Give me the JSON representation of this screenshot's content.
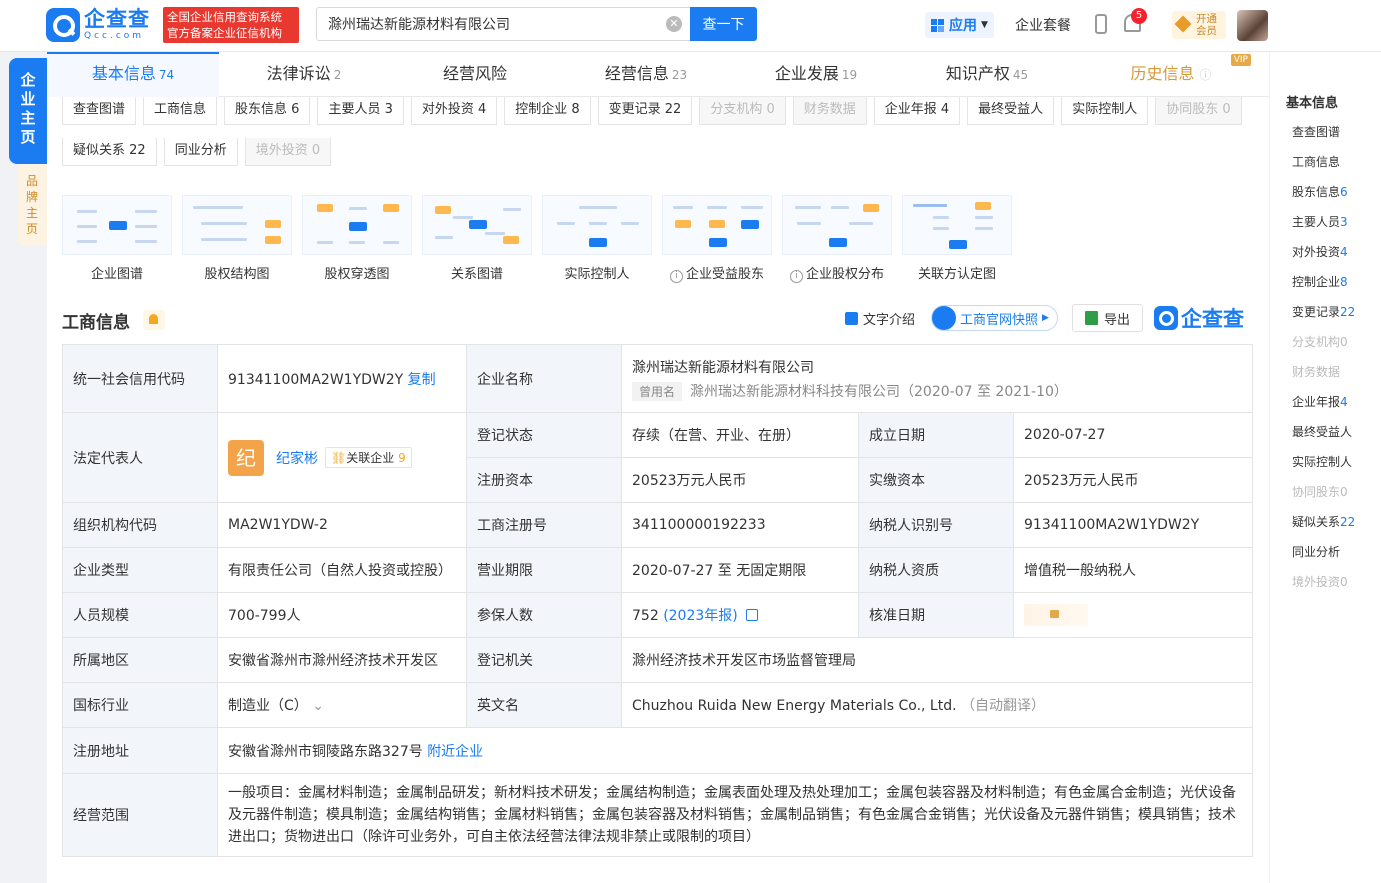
{
  "header": {
    "logo_cn": "企查查",
    "logo_en": "Qcc.com",
    "slogan_line1": "全国企业信用查询系统",
    "slogan_line2": "官方备案企业征信机构",
    "search_value": "滁州瑞达新能源材料有限公司",
    "search_button": "查一下",
    "apps_label": "应用",
    "plans_label": "企业套餐",
    "notification_count": "5",
    "vip_line1": "开通",
    "vip_line2": "会员"
  },
  "side_tabs": {
    "primary": [
      "企",
      "业",
      "主",
      "页"
    ],
    "secondary": [
      "品",
      "牌",
      "主",
      "页"
    ]
  },
  "tabs": [
    {
      "label": "基本信息",
      "count": "74",
      "active": true
    },
    {
      "label": "法律诉讼",
      "count": "2"
    },
    {
      "label": "经营风险",
      "count": ""
    },
    {
      "label": "经营信息",
      "count": "23"
    },
    {
      "label": "企业发展",
      "count": "19"
    },
    {
      "label": "知识产权",
      "count": "45"
    },
    {
      "label": "历史信息",
      "count": "",
      "vip": "VIP"
    }
  ],
  "chips": [
    {
      "label": "查查图谱",
      "disabled": false
    },
    {
      "label": "工商信息",
      "disabled": false
    },
    {
      "label": "股东信息 6",
      "disabled": false
    },
    {
      "label": "主要人员 3",
      "disabled": false
    },
    {
      "label": "对外投资 4",
      "disabled": false
    },
    {
      "label": "控制企业 8",
      "disabled": false
    },
    {
      "label": "变更记录 22",
      "disabled": false
    },
    {
      "label": "分支机构 0",
      "disabled": true
    },
    {
      "label": "财务数据",
      "disabled": true
    },
    {
      "label": "企业年报 4",
      "disabled": false
    },
    {
      "label": "最终受益人",
      "disabled": false
    },
    {
      "label": "实际控制人",
      "disabled": false
    },
    {
      "label": "协同股东 0",
      "disabled": true
    },
    {
      "label": "疑似关系 22",
      "disabled": false
    },
    {
      "label": "同业分析",
      "disabled": false
    },
    {
      "label": "境外投资 0",
      "disabled": true
    }
  ],
  "graphs": [
    {
      "label": "企业图谱",
      "info": false
    },
    {
      "label": "股权结构图",
      "info": false
    },
    {
      "label": "股权穿透图",
      "info": false
    },
    {
      "label": "关系图谱",
      "info": false
    },
    {
      "label": "实际控制人",
      "info": false
    },
    {
      "label": "企业受益股东",
      "info": true
    },
    {
      "label": "企业股权分布",
      "info": true
    },
    {
      "label": "关联方认定图",
      "info": false
    }
  ],
  "section": {
    "title": "工商信息",
    "intro": "文字介绍",
    "snapshot": "工商官网快照",
    "export": "导出",
    "brand": "企查查"
  },
  "info": {
    "credit_code_label": "统一社会信用代码",
    "credit_code": "91341100MA2W1YDW2Y",
    "copy": "复制",
    "company_name_label": "企业名称",
    "company_name": "滁州瑞达新能源材料有限公司",
    "former_tag": "曾用名",
    "former_name": "滁州瑞达新能源材料科技有限公司（2020-07 至 2021-10）",
    "legal_rep_label": "法定代表人",
    "legal_rep_avatar": "纪",
    "legal_rep_name": "纪家彬",
    "related_label": "关联企业",
    "related_count": "9",
    "status_label": "登记状态",
    "status": "存续（在营、开业、在册）",
    "founded_label": "成立日期",
    "founded": "2020-07-27",
    "reg_capital_label": "注册资本",
    "reg_capital": "20523万元人民币",
    "paid_capital_label": "实缴资本",
    "paid_capital": "20523万元人民币",
    "org_code_label": "组织机构代码",
    "org_code": "MA2W1YDW-2",
    "reg_no_label": "工商注册号",
    "reg_no": "341100000192233",
    "taxpayer_id_label": "纳税人识别号",
    "taxpayer_id": "91341100MA2W1YDW2Y",
    "type_label": "企业类型",
    "type": "有限责任公司（自然人投资或控股）",
    "term_label": "营业期限",
    "term": "2020-07-27 至 无固定期限",
    "tax_qual_label": "纳税人资质",
    "tax_qual": "增值税一般纳税人",
    "staff_label": "人员规模",
    "staff": "700-799人",
    "insured_label": "参保人数",
    "insured": "752",
    "insured_report": "(2023年报)",
    "approve_label": "核准日期",
    "region_label": "所属地区",
    "region": "安徽省滁州市滁州经济技术开发区",
    "authority_label": "登记机关",
    "authority": "滁州经济技术开发区市场监督管理局",
    "industry_label": "国标行业",
    "industry": "制造业（C）",
    "en_name_label": "英文名",
    "en_name": "Chuzhou Ruida New Energy Materials Co., Ltd.",
    "en_note": "（自动翻译）",
    "address_label": "注册地址",
    "address": "安徽省滁州市铜陵路东路327号",
    "nearby": "附近企业",
    "scope_label": "经营范围",
    "scope": "一般项目：金属材料制造；金属制品研发；新材料技术研发；金属结构制造；金属表面处理及热处理加工；金属包装容器及材料制造；有色金属合金制造；光伏设备及元器件制造；模具制造；金属结构销售；金属材料销售；金属包装容器及材料销售；金属制品销售；有色金属合金销售；光伏设备及元器件销售；模具销售；技术进出口；货物进出口（除许可业务外，可自主依法经营法律法规非禁止或限制的项目）"
  },
  "right_nav": {
    "title": "基本信息",
    "items": [
      {
        "label": "查查图谱",
        "count": "",
        "disabled": false
      },
      {
        "label": "工商信息",
        "count": "",
        "disabled": false
      },
      {
        "label": "股东信息",
        "count": "6",
        "disabled": false
      },
      {
        "label": "主要人员",
        "count": "3",
        "disabled": false
      },
      {
        "label": "对外投资",
        "count": "4",
        "disabled": false
      },
      {
        "label": "控制企业",
        "count": "8",
        "disabled": false
      },
      {
        "label": "变更记录",
        "count": "22",
        "disabled": false
      },
      {
        "label": "分支机构",
        "count": "0",
        "disabled": true
      },
      {
        "label": "财务数据",
        "count": "",
        "disabled": true
      },
      {
        "label": "企业年报",
        "count": "4",
        "disabled": false
      },
      {
        "label": "最终受益人",
        "count": "",
        "disabled": false
      },
      {
        "label": "实际控制人",
        "count": "",
        "disabled": false
      },
      {
        "label": "协同股东",
        "count": "0",
        "disabled": true
      },
      {
        "label": "疑似关系",
        "count": "22",
        "disabled": false
      },
      {
        "label": "同业分析",
        "count": "",
        "disabled": false
      },
      {
        "label": "境外投资",
        "count": "0",
        "disabled": true
      }
    ]
  },
  "colors": {
    "brand": "#1a7cf0",
    "accent": "#f5a623",
    "danger": "#e8382f"
  }
}
